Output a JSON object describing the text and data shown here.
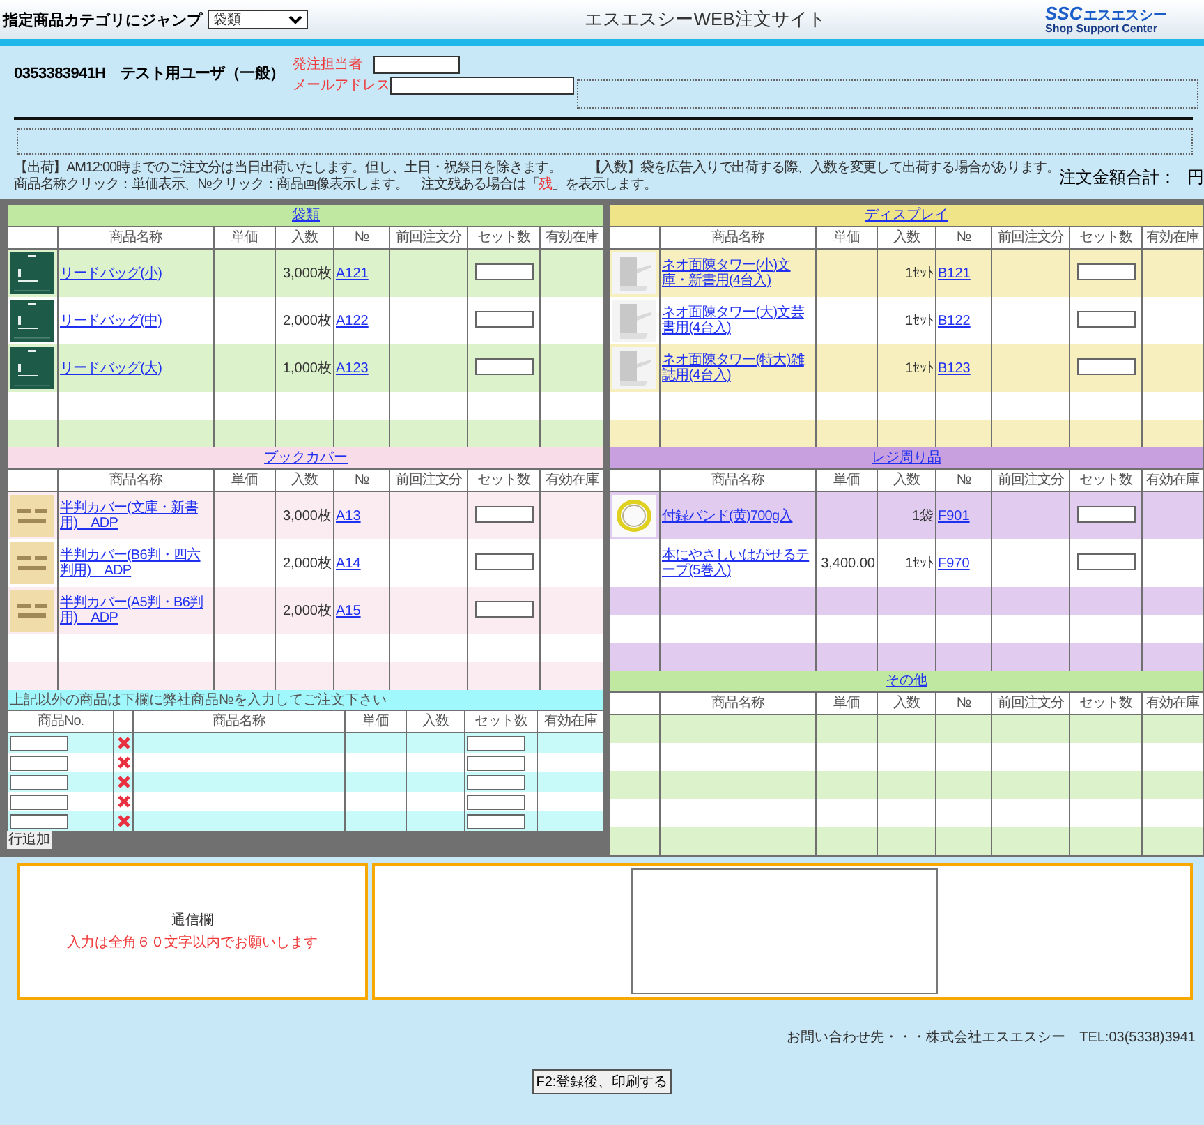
{
  "header": {
    "jump_label": "指定商品カテゴリにジャンプ",
    "jump_select": "袋類",
    "title": "エスエスシーWEB注文サイト",
    "logo": {
      "mark": "SSC",
      "name": "エスエスシー",
      "tagline": "Shop Support Center"
    }
  },
  "user": {
    "id_name": "0353383941H　テスト用ユーザ（一般）",
    "fields": [
      {
        "label": "発注担当者"
      },
      {
        "label": "メールアドレス"
      }
    ]
  },
  "notes": {
    "shipping": "【出荷】AM12:00時までのご注文分は当日出荷いたします。但し、土日・祝祭日を除きます。",
    "pack": "【入数】袋を広告入りで出荷する際、入数を変更して出荷する場合があります。",
    "click_before": "商品名称クリック：単価表示、№クリック：商品画像表示します。　注文残ある場合は「",
    "click_mark": "残",
    "click_after": "」を表示します。"
  },
  "total": {
    "label": "注文金額合計：",
    "unit": "円"
  },
  "left_sections": [
    {
      "title": "袋類",
      "color": "#c0e8a0",
      "columns": [
        "商品名称",
        "単価",
        "入数",
        "№",
        "前回注文分",
        "セット数",
        "有効在庫"
      ],
      "items": [
        {
          "kind": "picture",
          "name": "リードバッグ(小)",
          "qty": "3,000枚",
          "code": "A121"
        },
        {
          "kind": "picture",
          "name": "リードバッグ(中)",
          "qty": "2,000枚",
          "code": "A122"
        },
        {
          "kind": "picture",
          "name": "リードバッグ(大)",
          "qty": "1,000枚",
          "code": "A123"
        }
      ]
    },
    {
      "title": "ブックカバー",
      "color": "#f8dce8",
      "columns": [
        "商品名称",
        "単価",
        "入数",
        "№",
        "前回注文分",
        "セット数",
        "有効在庫"
      ],
      "items": [
        {
          "kind": "picture",
          "name": "半判カバー(文庫・新書用)　ADP",
          "qty": "3,000枚",
          "code": "A13"
        },
        {
          "kind": "picture",
          "name": "半判カバー(B6判・四六判用)　ADP",
          "qty": "2,000枚",
          "code": "A14"
        },
        {
          "kind": "picture",
          "name": "半判カバー(A5判・B6判用)　ADP",
          "qty": "2,000枚",
          "code": "A15"
        }
      ]
    }
  ],
  "custom_order": {
    "note": "上記以外の商品は下欄に弊社商品№を入力してご注文下さい",
    "columns": [
      "商品No.",
      "商品名称",
      "単価",
      "入数",
      "セット数",
      "有効在庫"
    ],
    "rows": [
      {
        "kind": "entry"
      },
      {
        "kind": "entry"
      },
      {
        "kind": "entry"
      },
      {
        "kind": "entry"
      },
      {
        "kind": "entry"
      }
    ],
    "add_button": "行追加"
  },
  "right_sections": [
    {
      "title": "ディスプレイ",
      "color": "#f0e488",
      "columns": [
        "商品名称",
        "単価",
        "入数",
        "№",
        "前回注文分",
        "セット数",
        "有効在庫"
      ],
      "items": [
        {
          "kind": "picture",
          "name": "ネオ面陳タワー(小)文庫・新書用(4台入)",
          "qty": "1ｾｯﾄ",
          "code": "B121"
        },
        {
          "kind": "picture",
          "name": "ネオ面陳タワー(大)文芸書用(4台入)",
          "qty": "1ｾｯﾄ",
          "code": "B122"
        },
        {
          "kind": "picture",
          "name": "ネオ面陳タワー(特大)雑誌用(4台入)",
          "qty": "1ｾｯﾄ",
          "code": "B123"
        }
      ]
    },
    {
      "title": "レジ周り品",
      "color": "#c8a0e0",
      "columns": [
        "商品名称",
        "単価",
        "入数",
        "№",
        "前回注文分",
        "セット数",
        "有効在庫"
      ],
      "items": [
        {
          "kind": "picture",
          "name": "付録バンド(黄)700g入",
          "qty": "1袋",
          "code": "F901"
        },
        {
          "name": "本にやさしいはがせるテープ(5巻入)",
          "price": "3,400.00",
          "qty": "1ｾｯﾄ",
          "code": "F970"
        }
      ]
    },
    {
      "title": "その他",
      "color": "#c0e8a0",
      "columns": [
        "商品名称",
        "単価",
        "入数",
        "№",
        "前回注文分",
        "セット数",
        "有効在庫"
      ]
    }
  ],
  "message": {
    "label": "通信欄",
    "hint": "入力は全角６０文字以内でお願いします"
  },
  "contact": "お問い合わせ先・・・株式会社エスエスシー　TEL:03(5338)3941",
  "submit_button": "F2:登録後、印刷する"
}
